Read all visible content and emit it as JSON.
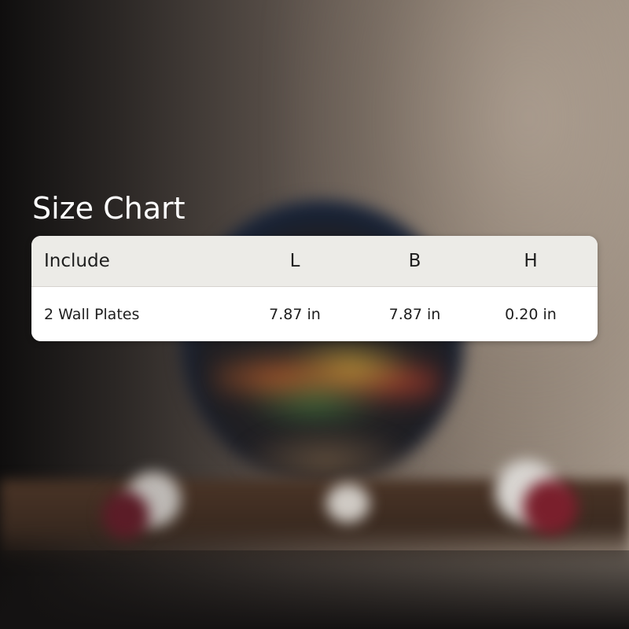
{
  "title": "Size Chart",
  "table": {
    "headers": [
      "Include",
      "L",
      "B",
      "H"
    ],
    "rows": [
      [
        "2 Wall Plates",
        "7.87 in",
        "7.87 in",
        "0.20 in"
      ]
    ]
  },
  "colors": {
    "title_text": "#ffffff",
    "header_background": "#ecebe7",
    "body_background": "#ffffff",
    "cell_text": "#1e1e1e"
  }
}
